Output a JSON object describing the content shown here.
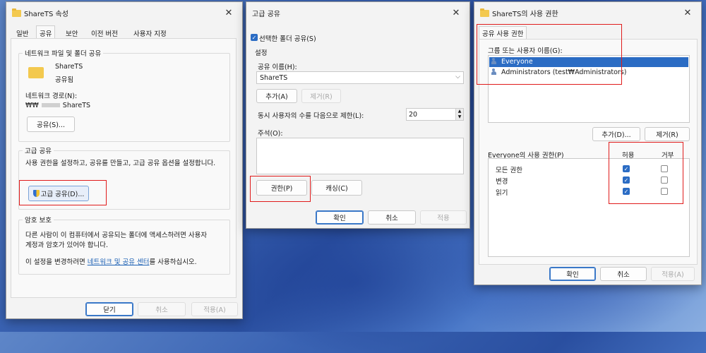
{
  "props": {
    "title": "ShareTS 속성",
    "tabs": [
      "일반",
      "공유",
      "보안",
      "이전 버전",
      "사용자 지정"
    ],
    "net_group_title": "네트워크 파일 및 폴더 공유",
    "folder_name": "ShareTS",
    "folder_status": "공유됨",
    "net_path_label": "네트워크 경로(N):",
    "net_path_value_prefix": "₩₩",
    "net_path_value_suffix": "ShareTS",
    "share_button": "공유(S)...",
    "adv_group_title": "고급 공유",
    "adv_desc": "사용 권한을 설정하고, 공유를 만들고, 고급 공유 옵션을 설정합니다.",
    "adv_button": "고급 공유(D)...",
    "pw_group_title": "암호 보호",
    "pw_desc1": "다른 사람이 이 컴퓨터에서 공유되는 폴더에 액세스하려면 사용자",
    "pw_desc2": "계정과 암호가 있어야 합니다.",
    "pw_change_prefix": "이 설정을 변경하려면",
    "pw_change_link": "네트워크 및 공유 센터",
    "pw_change_suffix": "를 사용하십시오.",
    "ok": "닫기",
    "cancel": "취소",
    "apply": "적용(A)"
  },
  "adv": {
    "title": "고급 공유",
    "share_checkbox": "선택한 폴더 공유(S)",
    "settings_label": "설정",
    "share_name_label": "공유 이름(H):",
    "share_name_value": "ShareTS",
    "add_button": "추가(A)",
    "remove_button": "제거(R)",
    "limit_label": "동시 사용자의 수를 다음으로 제한(L):",
    "limit_value": "20",
    "comment_label": "주석(O):",
    "perm_button": "권한(P)",
    "cache_button": "캐싱(C)",
    "ok": "확인",
    "cancel": "취소",
    "apply": "적용"
  },
  "perm": {
    "title": "ShareTS의 사용 권한",
    "tab": "공유 사용 권한",
    "users_label": "그룹 또는 사용자 이름(G):",
    "users": [
      "Everyone",
      "Administrators (test₩Administrators)"
    ],
    "add_button": "추가(D)...",
    "remove_button": "제거(R)",
    "perm_label": "Everyone의 사용 권한(P)",
    "allow_header": "허용",
    "deny_header": "거부",
    "rows": [
      {
        "name": "모든 권한",
        "allow": true,
        "deny": false
      },
      {
        "name": "변경",
        "allow": true,
        "deny": false
      },
      {
        "name": "읽기",
        "allow": true,
        "deny": false
      }
    ],
    "ok": "확인",
    "cancel": "취소",
    "apply": "적용(A)"
  }
}
